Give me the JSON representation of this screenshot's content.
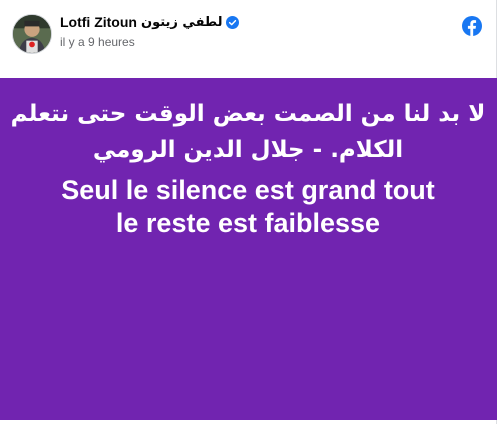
{
  "post": {
    "author": {
      "name": "Lotfi Zitoun",
      "name_ar": "لطفي زيتون",
      "verified_icon": "verified-badge-icon",
      "avatar_icon": "avatar"
    },
    "timestamp": "il y a 9 heures",
    "platform_icon": "facebook-logo-icon",
    "colors": {
      "card_background": "#7124b0",
      "card_text": "#ffffff",
      "verified": "#1877f2",
      "facebook_blue": "#1877f2"
    },
    "quote": {
      "arabic_line1": "لا بد لنا من الصمت بعض الوقت حتى نتعلم",
      "arabic_line2": "الكلام. - جلال الدين الرومي",
      "french_line1": "Seul le silence est grand tout",
      "french_line2": "le reste est faiblesse"
    }
  }
}
